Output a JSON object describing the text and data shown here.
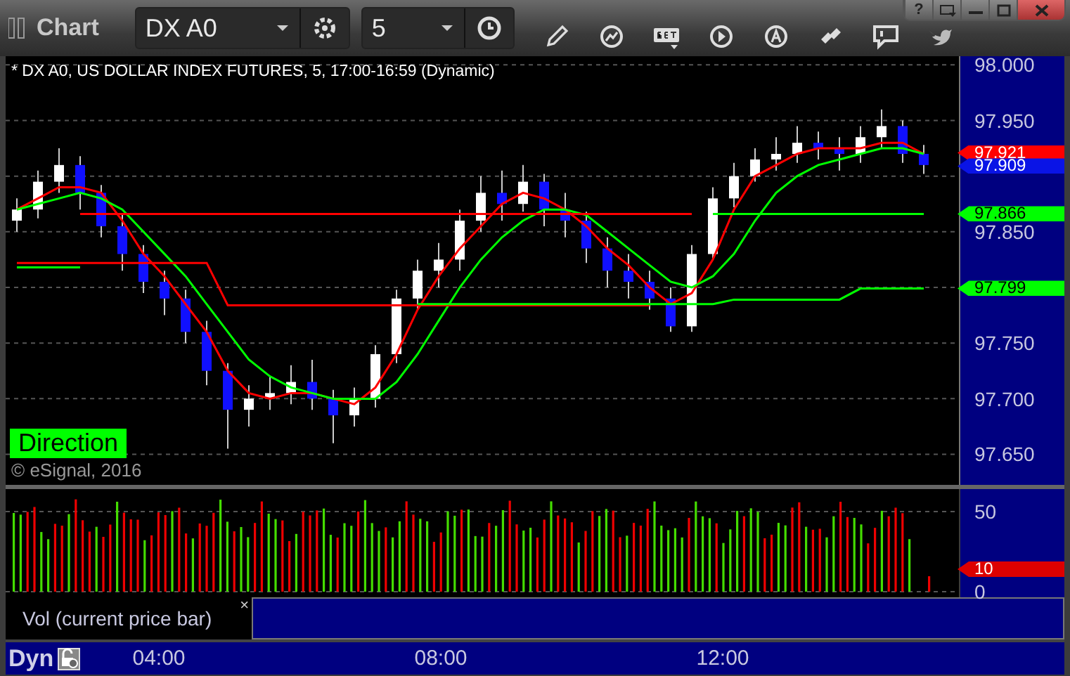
{
  "toolbar": {
    "title": "Chart",
    "symbol": "DX A0",
    "interval": "5"
  },
  "window_buttons": {
    "help": "?"
  },
  "price_panel": {
    "header": "* DX A0, US DOLLAR INDEX FUTURES, 5, 17:00-16:59 (Dynamic)",
    "study_label": "Direction",
    "copyright": "© eSignal, 2016",
    "chart_data": {
      "type": "candlestick",
      "ylim": [
        97.6225,
        98.0078
      ],
      "grid": true,
      "ohlc": [
        [
          97.86,
          97.88,
          97.85,
          97.87
        ],
        [
          97.87,
          97.905,
          97.862,
          97.895
        ],
        [
          97.895,
          97.925,
          97.885,
          97.91
        ],
        [
          97.91,
          97.918,
          97.87,
          97.885
        ],
        [
          97.885,
          97.892,
          97.845,
          97.855
        ],
        [
          97.855,
          97.865,
          97.815,
          97.83
        ],
        [
          97.83,
          97.838,
          97.795,
          97.805
        ],
        [
          97.805,
          97.815,
          97.775,
          97.79
        ],
        [
          97.79,
          97.798,
          97.75,
          97.76
        ],
        [
          97.76,
          97.77,
          97.712,
          97.725
        ],
        [
          97.725,
          97.732,
          97.655,
          97.69
        ],
        [
          97.69,
          97.712,
          97.675,
          97.7
        ],
        [
          97.7,
          97.72,
          97.69,
          97.705
        ],
        [
          97.705,
          97.73,
          97.695,
          97.715
        ],
        [
          97.715,
          97.735,
          97.69,
          97.7
        ],
        [
          97.7,
          97.708,
          97.66,
          97.685
        ],
        [
          97.685,
          97.71,
          97.675,
          97.7
        ],
        [
          97.7,
          97.748,
          97.692,
          97.74
        ],
        [
          97.74,
          97.798,
          97.732,
          97.79
        ],
        [
          97.79,
          97.825,
          97.78,
          97.815
        ],
        [
          97.815,
          97.84,
          97.8,
          97.825
        ],
        [
          97.825,
          97.87,
          97.815,
          97.86
        ],
        [
          97.86,
          97.9,
          97.85,
          97.885
        ],
        [
          97.885,
          97.905,
          97.86,
          97.875
        ],
        [
          97.875,
          97.91,
          97.868,
          97.895
        ],
        [
          97.895,
          97.902,
          97.855,
          97.87
        ],
        [
          97.87,
          97.885,
          97.845,
          97.86
        ],
        [
          97.86,
          97.868,
          97.822,
          97.835
        ],
        [
          97.835,
          97.845,
          97.8,
          97.815
        ],
        [
          97.815,
          97.83,
          97.79,
          97.805
        ],
        [
          97.805,
          97.815,
          97.78,
          97.79
        ],
        [
          97.79,
          97.8,
          97.76,
          97.765
        ],
        [
          97.765,
          97.838,
          97.76,
          97.83
        ],
        [
          97.83,
          97.89,
          97.825,
          97.88
        ],
        [
          97.88,
          97.912,
          97.872,
          97.9
        ],
        [
          97.9,
          97.925,
          97.895,
          97.915
        ],
        [
          97.915,
          97.935,
          97.905,
          97.92
        ],
        [
          97.92,
          97.945,
          97.912,
          97.93
        ],
        [
          97.93,
          97.94,
          97.915,
          97.925
        ],
        [
          97.925,
          97.935,
          97.905,
          97.92
        ],
        [
          97.92,
          97.945,
          97.912,
          97.935
        ],
        [
          97.935,
          97.96,
          97.925,
          97.945
        ],
        [
          97.945,
          97.95,
          97.912,
          97.92
        ],
        [
          97.92,
          97.928,
          97.902,
          97.91
        ]
      ],
      "yticks": [
        {
          "value": 98.0,
          "label": "98.000"
        },
        {
          "value": 97.95,
          "label": "97.950"
        },
        {
          "value": 97.85,
          "label": "97.850"
        },
        {
          "value": 97.75,
          "label": "97.750"
        },
        {
          "value": 97.7,
          "label": "97.700"
        },
        {
          "value": 97.65,
          "label": "97.650"
        }
      ],
      "series": [
        {
          "type": "line",
          "color": "#ff0000",
          "values": [
            97.87,
            97.88,
            97.89,
            97.89,
            97.885,
            97.86,
            97.83,
            97.81,
            97.785,
            97.76,
            97.725,
            97.705,
            97.7,
            97.705,
            97.705,
            97.7,
            97.695,
            97.71,
            97.74,
            97.78,
            97.81,
            97.835,
            97.855,
            97.875,
            97.885,
            97.88,
            97.87,
            97.855,
            97.835,
            97.82,
            97.8,
            97.785,
            97.795,
            97.825,
            97.87,
            97.9,
            97.91,
            97.92,
            97.925,
            97.925,
            97.925,
            97.93,
            97.93,
            97.92
          ]
        },
        {
          "type": "line",
          "color": "#00ff00",
          "values": [
            97.87,
            97.875,
            97.88,
            97.885,
            97.88,
            97.87,
            97.85,
            97.83,
            97.81,
            97.785,
            97.76,
            97.735,
            97.72,
            97.71,
            97.705,
            97.7,
            97.7,
            97.7,
            97.715,
            97.74,
            97.77,
            97.8,
            97.825,
            97.845,
            97.86,
            97.87,
            97.87,
            97.865,
            97.85,
            97.835,
            97.82,
            97.805,
            97.8,
            97.81,
            97.83,
            97.86,
            97.885,
            97.9,
            97.91,
            97.915,
            97.92,
            97.925,
            97.925,
            97.92
          ]
        },
        {
          "type": "line",
          "color": "#ff0000",
          "values": [
            null,
            null,
            null,
            97.866,
            97.866,
            97.866,
            97.866,
            97.866,
            97.866,
            97.866,
            97.866,
            97.866,
            97.866,
            97.866,
            97.866,
            97.866,
            97.866,
            97.866,
            97.866,
            97.866,
            97.866,
            97.866,
            97.866,
            97.866,
            97.866,
            97.866,
            97.866,
            97.866,
            97.866,
            97.866,
            97.866,
            97.866,
            97.866,
            null,
            null,
            null,
            null,
            null,
            null,
            null,
            null,
            null,
            null,
            null
          ]
        },
        {
          "type": "line",
          "color": "#ff0000",
          "values": [
            97.822,
            97.822,
            97.822,
            97.822,
            97.822,
            97.822,
            97.822,
            97.822,
            97.822,
            97.822,
            97.784,
            97.784,
            97.784,
            97.784,
            97.784,
            97.784,
            97.784,
            97.784,
            97.784,
            97.784,
            97.784,
            97.784,
            97.784,
            97.784,
            97.784,
            97.784,
            97.784,
            97.784,
            97.784,
            97.784,
            97.784,
            null,
            null,
            null,
            null,
            null,
            null,
            null,
            null,
            null,
            null,
            null,
            null,
            null
          ]
        },
        {
          "type": "line",
          "color": "#00ff00",
          "values": [
            97.818,
            97.818,
            97.818,
            97.818,
            null,
            null,
            null,
            null,
            null,
            null,
            null,
            null,
            null,
            null,
            null,
            null,
            null,
            null,
            null,
            97.785,
            97.785,
            97.785,
            97.785,
            97.785,
            97.785,
            97.785,
            97.785,
            97.785,
            97.785,
            97.785,
            97.785,
            97.785,
            97.785,
            97.785,
            97.789,
            97.789,
            97.789,
            97.789,
            97.789,
            97.789,
            97.799,
            97.799,
            97.799,
            97.799
          ]
        },
        {
          "type": "line",
          "color": "#00ff00",
          "values": [
            null,
            null,
            null,
            null,
            null,
            null,
            null,
            null,
            null,
            null,
            null,
            null,
            null,
            null,
            null,
            null,
            null,
            null,
            null,
            null,
            null,
            null,
            null,
            null,
            null,
            null,
            null,
            null,
            null,
            null,
            null,
            null,
            null,
            97.866,
            97.866,
            97.866,
            97.866,
            97.866,
            97.866,
            97.866,
            97.866,
            97.866,
            97.866,
            97.866
          ]
        }
      ]
    },
    "markers": [
      {
        "value": "97.921",
        "color": "#ff0000"
      },
      {
        "value": "97.909",
        "color": "#0a14e6"
      },
      {
        "value": "97.866",
        "color": "#00ff00"
      },
      {
        "value": "97.799",
        "color": "#00ff00"
      }
    ]
  },
  "volume_panel": {
    "axis_labels": [
      "50",
      "0"
    ],
    "marker": {
      "value": "10",
      "color": "#dd0000"
    },
    "legend": "Vol (current price bar)",
    "legend_close": "×"
  },
  "time_axis": {
    "mode": "Dyn",
    "labels": [
      "04:00",
      "08:00",
      "12:00"
    ]
  }
}
